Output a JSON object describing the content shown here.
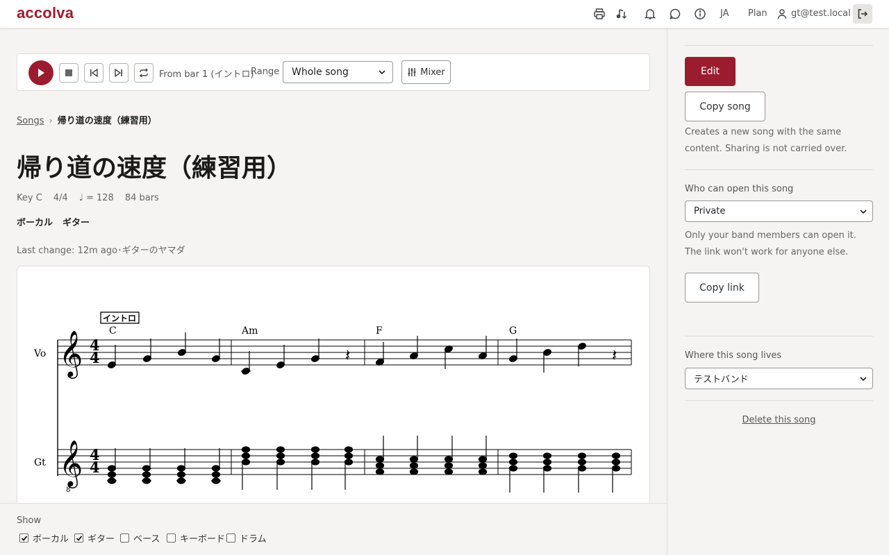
{
  "header": {
    "logo": "accolva",
    "language": "JA",
    "plan": "Plan",
    "user": "gt@test.local"
  },
  "player": {
    "from_bar": "From bar 1 (イントロ)",
    "range_label": "Range",
    "range_value": "Whole song",
    "mixer_label": "Mixer"
  },
  "breadcrumb": {
    "root": "Songs",
    "current": "帰り道の速度（練習用）"
  },
  "song": {
    "title": "帰り道の速度（練習用）",
    "key": "Key C",
    "time_signature": "4/4",
    "tempo": "♩ = 128",
    "bars": "84 bars",
    "parts": [
      "ボーカル",
      "ギター"
    ],
    "last_change": "Last change: 12m ago･ギターのヤマダ"
  },
  "score": {
    "rehearsal_mark": "イントロ",
    "chords": [
      "C",
      "Am",
      "F",
      "G"
    ],
    "staves": [
      "Vo",
      "Gt"
    ]
  },
  "show": {
    "label": "Show",
    "items": [
      {
        "label": "ボーカル",
        "checked": true
      },
      {
        "label": "ギター",
        "checked": true
      },
      {
        "label": "ベース",
        "checked": false
      },
      {
        "label": "キーボード",
        "checked": false
      },
      {
        "label": "ドラム",
        "checked": false
      }
    ]
  },
  "sidebar": {
    "edit_label": "Edit",
    "copy_song_label": "Copy song",
    "copy_song_note": "Creates a new song with the same content. Sharing is not carried over.",
    "access_label": "Who can open this song",
    "access_value": "Private",
    "access_note": "Only your band members can open it. The link won't work for anyone else.",
    "copy_link_label": "Copy link",
    "location_label": "Where this song lives",
    "location_value": "テストバンド",
    "delete_label": "Delete this song"
  },
  "colors": {
    "brand": "#9b1c2e"
  }
}
